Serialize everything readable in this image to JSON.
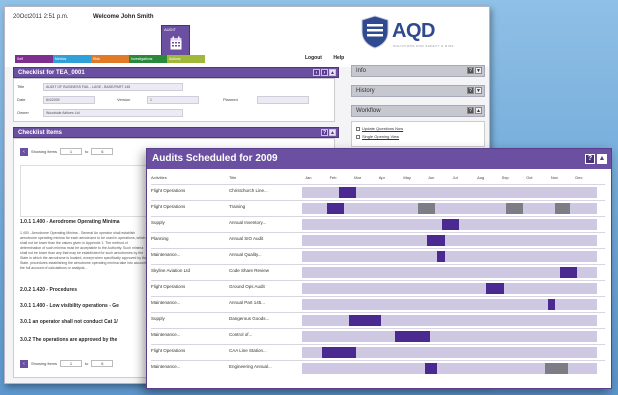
{
  "header": {
    "datetime": "20Oct2011 2:51 p.m.",
    "welcome": "Welcome John Smith",
    "nav_tile_label": "AUDIT",
    "links": {
      "logout": "Logout",
      "help": "Help"
    },
    "menu": [
      {
        "label": "Self",
        "color": "#7f2f8f"
      },
      {
        "label": "Metrics",
        "color": "#2fa0d8"
      },
      {
        "label": "Risk",
        "color": "#e07a26"
      },
      {
        "label": "Investigations",
        "color": "#2a8a3c"
      },
      {
        "label": "Actions",
        "color": "#9fb83a"
      }
    ]
  },
  "logo": {
    "text": "AQD",
    "tagline": "SOLUTIONS FOR SAFETY & RISK"
  },
  "checklist": {
    "title": "Checklist for TEA_0001",
    "fields": [
      {
        "label": "Title",
        "value": "AUDIT OF BUSINESS FAIL - LASE - BASE/PART 145"
      },
      {
        "label": "Date",
        "value": "8/4/2009"
      },
      {
        "label": "Version",
        "value": "1"
      },
      {
        "label": "Planned",
        "value": ""
      },
      {
        "label": "Owner",
        "value": "Woodside Airlines Ltd"
      }
    ]
  },
  "checklist_items": {
    "title": "Checklist Items",
    "pager": {
      "label": "Showing items",
      "from": "1",
      "to": "6"
    },
    "items": [
      "1.0.1 1.400 - Aerodrome Operating Minima",
      "2.0.2 1.420 - Procedures",
      "3.0.1 1.400 - Low visibility operations - Ge",
      "3.0.1 an operator shall not conduct Cat 1/",
      "3.0.2 The operations are approved by the"
    ],
    "desc": "1.400 - Aerodrome Operating Minima - General  An operator shall establish aerodrome operating minima for each aerodrome to be used in operations, which shall not be lower than the values given in Appendix 1. The method of determination of such minima must be acceptable to the Authority. Such minima shall not be lower than any that may be established for such aerodromes by the State in which the aerodrome is located, except when specifically approved by that State. procedures establishing the aerodrome operating minima take into account the full account of calculations or analysis..."
  },
  "sidebar": {
    "info": "Info",
    "history": "History",
    "workflow": {
      "title": "Workflow",
      "items": [
        "Update Questions Now",
        "Single Opening View"
      ]
    }
  },
  "audits": {
    "title": "Audits Scheduled for 2009",
    "headers": {
      "activity": "Activities",
      "title": "Title"
    },
    "months": [
      "Jan",
      "Feb",
      "Mar",
      "Apr",
      "May",
      "Jun",
      "Jul",
      "Aug",
      "Sep",
      "Oct",
      "Nov",
      "Dec"
    ],
    "rows": [
      {
        "activity": "Flight Operations",
        "title": "Christchurch Line...",
        "bars": [
          {
            "start": 1.5,
            "end": 2.2,
            "color": "#4a2a90"
          }
        ]
      },
      {
        "activity": "Flight Operations",
        "title": "Training",
        "bars": [
          {
            "start": 1.0,
            "end": 1.7,
            "color": "#4a2a90"
          },
          {
            "start": 4.7,
            "end": 5.4,
            "color": "#7d7d86"
          },
          {
            "start": 8.3,
            "end": 9.0,
            "color": "#7d7d86"
          },
          {
            "start": 10.3,
            "end": 10.9,
            "color": "#7d7d86"
          }
        ]
      },
      {
        "activity": "Supply",
        "title": "Annual Inventory...",
        "bars": [
          {
            "start": 5.7,
            "end": 6.4,
            "color": "#4a2a90"
          }
        ]
      },
      {
        "activity": "Planning",
        "title": "Annual SIO Audit",
        "bars": [
          {
            "start": 5.1,
            "end": 5.8,
            "color": "#4a2a90"
          }
        ]
      },
      {
        "activity": "Maintenance...",
        "title": "Annual Quality...",
        "bars": [
          {
            "start": 5.5,
            "end": 5.8,
            "color": "#4a2a90"
          }
        ]
      },
      {
        "activity": "Skyline Aviation Ltd",
        "title": "Code Share Review",
        "bars": [
          {
            "start": 10.5,
            "end": 11.2,
            "color": "#4a2a90"
          }
        ]
      },
      {
        "activity": "Flight Operations",
        "title": "Ground Ops Audit",
        "bars": [
          {
            "start": 7.5,
            "end": 8.2,
            "color": "#4a2a90"
          }
        ]
      },
      {
        "activity": "Maintenance...",
        "title": "Annual Part 145...",
        "bars": [
          {
            "start": 10.0,
            "end": 10.3,
            "color": "#4a2a90"
          }
        ]
      },
      {
        "activity": "Supply",
        "title": "Dangerous Goods...",
        "bars": [
          {
            "start": 1.9,
            "end": 3.2,
            "color": "#4a2a90"
          }
        ]
      },
      {
        "activity": "Maintenance...",
        "title": "Control of...",
        "bars": [
          {
            "start": 3.8,
            "end": 5.2,
            "color": "#4a2a90"
          }
        ]
      },
      {
        "activity": "Flight Operations",
        "title": "CAA Line Station...",
        "bars": [
          {
            "start": 0.8,
            "end": 2.2,
            "color": "#4a2a90"
          }
        ]
      },
      {
        "activity": "Maintenance...",
        "title": "Engineering Annual...",
        "bars": [
          {
            "start": 5.0,
            "end": 5.5,
            "color": "#4a2a90"
          },
          {
            "start": 9.9,
            "end": 10.8,
            "color": "#7d7d86"
          }
        ]
      }
    ]
  }
}
